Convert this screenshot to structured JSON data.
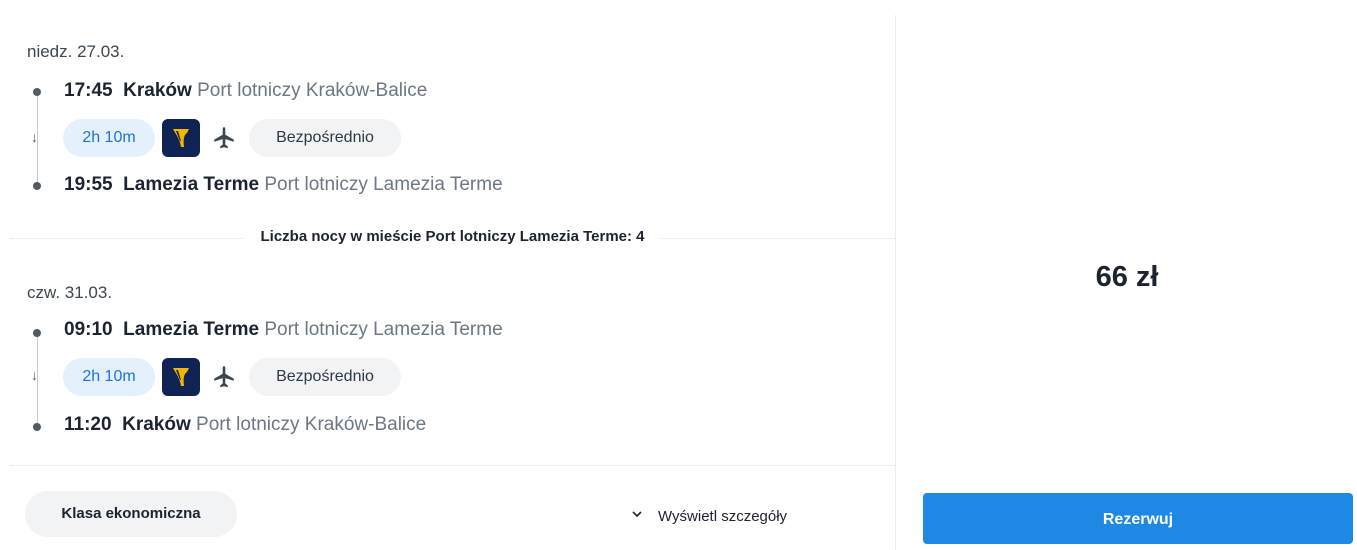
{
  "outbound": {
    "date": "niedz. 27.03.",
    "departure": {
      "time": "17:45",
      "city": "Kraków",
      "airport": "Port lotniczy Kraków-Balice"
    },
    "duration": "2h 10m",
    "carrier_icon": "harp-logo-icon",
    "stops_label": "Bezpośrednio",
    "arrival": {
      "time": "19:55",
      "city": "Lamezia Terme",
      "airport": "Port lotniczy Lamezia Terme"
    }
  },
  "nights_text": "Liczba nocy w mieście Port lotniczy Lamezia Terme: 4",
  "inbound": {
    "date": "czw. 31.03.",
    "departure": {
      "time": "09:10",
      "city": "Lamezia Terme",
      "airport": "Port lotniczy Lamezia Terme"
    },
    "duration": "2h 10m",
    "carrier_icon": "harp-logo-icon",
    "stops_label": "Bezpośrednio",
    "arrival": {
      "time": "11:20",
      "city": "Kraków",
      "airport": "Port lotniczy Kraków-Balice"
    }
  },
  "footer": {
    "class_label": "Klasa ekonomiczna",
    "details_label": "Wyświetl szczegóły"
  },
  "price": "66 zł",
  "book_label": "Rezerwuj",
  "colors": {
    "accent": "#1e88e5",
    "duration_bg": "#e4f1fc",
    "carrier_bg": "#0f2455",
    "carrier_logo": "#f2b705"
  }
}
